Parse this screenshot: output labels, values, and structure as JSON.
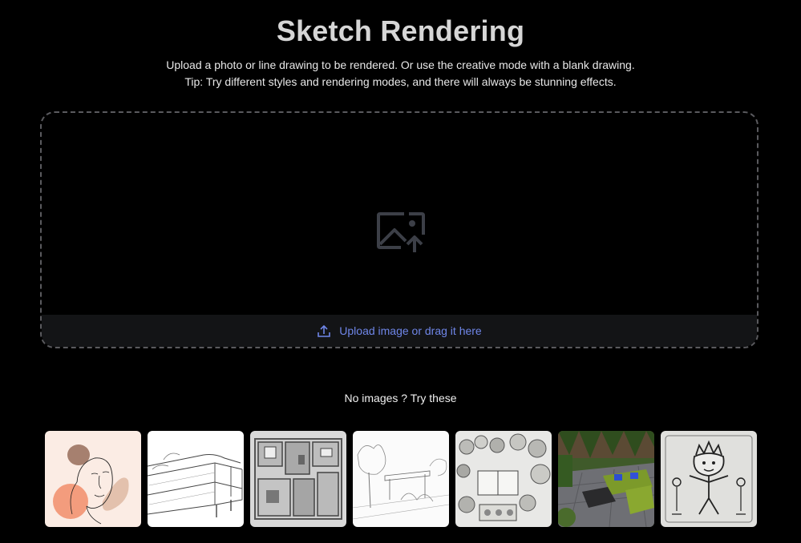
{
  "header": {
    "title": "Sketch Rendering",
    "subtitle_line1": "Upload a photo or line drawing to be rendered. Or use the creative mode with a blank drawing.",
    "subtitle_line2": "Tip: Try different styles and rendering modes, and there will always be stunning effects."
  },
  "upload": {
    "icon": "image-upload-icon",
    "bar_icon": "upload-arrow-icon",
    "label": "Upload image or drag it here",
    "accent_color": "#6f86e8"
  },
  "samples": {
    "label": "No images ? Try these",
    "items": [
      {
        "name": "line-art-portrait"
      },
      {
        "name": "sofa-sketch"
      },
      {
        "name": "floor-plan-sketch"
      },
      {
        "name": "garden-perspective-sketch"
      },
      {
        "name": "landscape-plan-sketch"
      },
      {
        "name": "patio-photo"
      },
      {
        "name": "doodle-character"
      }
    ]
  }
}
